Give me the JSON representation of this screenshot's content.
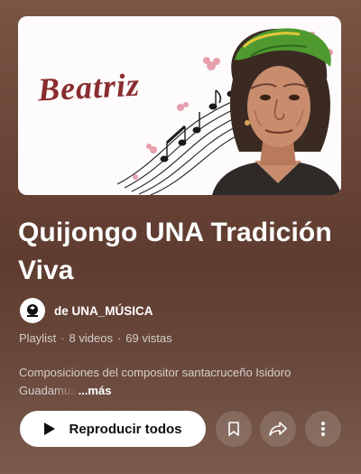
{
  "playlist": {
    "thumbnail_text": "Beatriz",
    "title_line1": "Quijongo UNA Tradición",
    "title_line2": "Viva",
    "channel_prefix": "de",
    "channel_name": "UNA_MÚSICA",
    "type": "Playlist",
    "video_count": "8 videos",
    "views": "69 vistas",
    "description_line1": "Composiciones del compositor santacruceño Isidoro",
    "description_line2": "Guadamuz",
    "more_label": "...más"
  },
  "actions": {
    "play_all_label": "Reproducir todos",
    "play_icon": "play-icon",
    "save_icon": "bookmark-icon",
    "share_icon": "share-icon",
    "more_icon": "more-vert-icon"
  },
  "colors": {
    "background": "#6b4537",
    "thumb_text": "#8a2d30",
    "scarf": "#4f9a2f"
  }
}
